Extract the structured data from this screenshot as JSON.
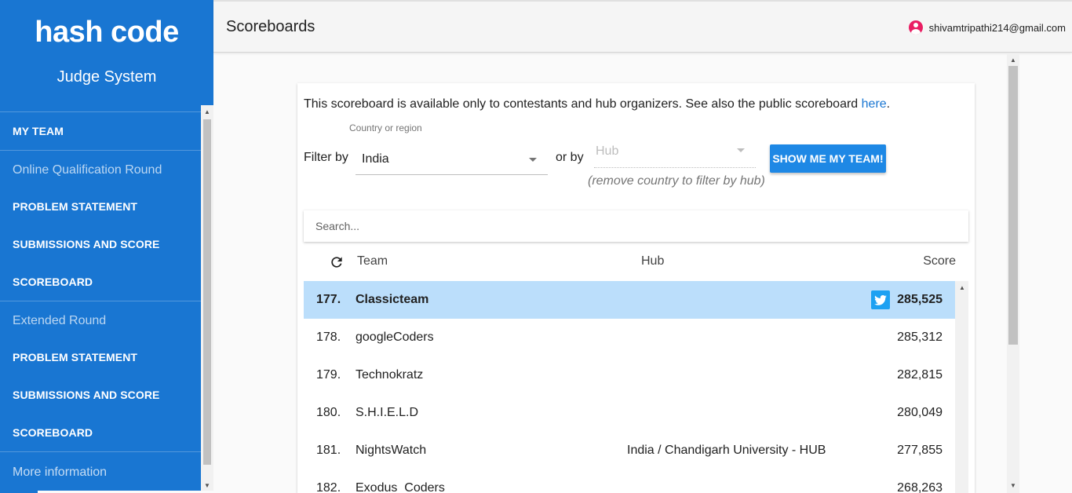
{
  "sidebar": {
    "logo": "hash code",
    "subtitle": "Judge System",
    "my_team": "MY TEAM",
    "sections": [
      {
        "title": "Online Qualification Round",
        "items": [
          "PROBLEM STATEMENT",
          "SUBMISSIONS AND SCORE",
          "SCOREBOARD"
        ]
      },
      {
        "title": "Extended Round",
        "items": [
          "PROBLEM STATEMENT",
          "SUBMISSIONS AND SCORE",
          "SCOREBOARD"
        ]
      }
    ],
    "more_info": "More information"
  },
  "header": {
    "title": "Scoreboards",
    "user_email": "shivamtripathi214@gmail.com"
  },
  "card": {
    "notice": "This scoreboard is available only to contestants and hub organizers. See also the public scoreboard ",
    "notice_link": "here",
    "notice_end": ".",
    "filter_label": "Filter by",
    "country_label": "Country or region",
    "country_value": "India",
    "or_by": "or by",
    "hub_placeholder": "Hub",
    "hub_hint": "(remove country to filter by hub)",
    "show_button": "SHOW ME MY TEAM!",
    "search_placeholder": "Search...",
    "columns": {
      "team": "Team",
      "hub": "Hub",
      "score": "Score"
    }
  },
  "rows": [
    {
      "rank": "177.",
      "team": "Classicteam",
      "hub": "",
      "score": "285,525",
      "highlight": true
    },
    {
      "rank": "178.",
      "team": "googleCoders",
      "hub": "",
      "score": "285,312"
    },
    {
      "rank": "179.",
      "team": "Technokratz",
      "hub": "",
      "score": "282,815"
    },
    {
      "rank": "180.",
      "team": "S.H.I.E.L.D",
      "hub": "",
      "score": "280,049"
    },
    {
      "rank": "181.",
      "team": "NightsWatch",
      "hub": "India / Chandigarh University - HUB",
      "score": "277,855"
    },
    {
      "rank": "182.",
      "team": "Exodus_Coders",
      "hub": "",
      "score": "268,263"
    }
  ],
  "colors": {
    "sidebar": "#1976d2",
    "highlight": "#bbdefb",
    "button": "#1e88e5",
    "twitter": "#1da1f2"
  }
}
